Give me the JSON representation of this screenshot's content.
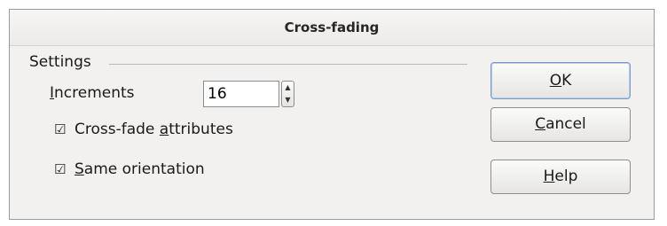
{
  "dialog": {
    "title": "Cross-fading"
  },
  "settings": {
    "group_label": "Settings",
    "increments": {
      "label_first": "I",
      "label_rest": "ncrements",
      "value": "16"
    },
    "cross_fade_attributes": {
      "checked": true,
      "label_pre": "Cross-fade ",
      "label_mnemonic": "a",
      "label_post": "ttributes"
    },
    "same_orientation": {
      "checked": true,
      "label_mnemonic": "S",
      "label_post": "ame orientation"
    }
  },
  "buttons": {
    "ok_mnemonic": "O",
    "ok_rest": "K",
    "cancel_mnemonic": "C",
    "cancel_rest": "ancel",
    "help_mnemonic": "H",
    "help_rest": "elp"
  },
  "icons": {
    "checkbox_checked": "☑",
    "spin_up": "▲",
    "spin_down": "▼"
  }
}
